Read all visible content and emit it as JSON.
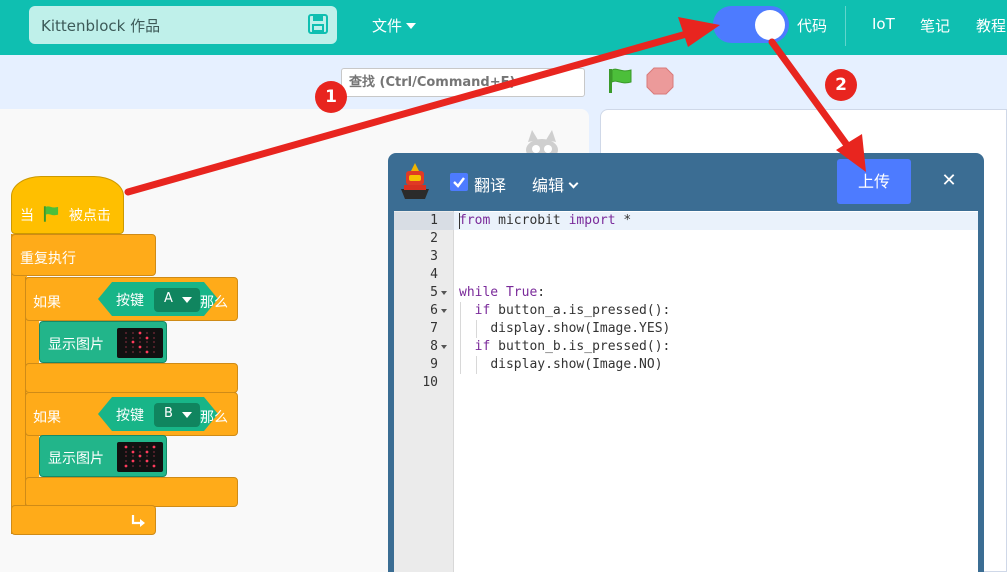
{
  "header": {
    "project_title": "Kittenblock 作品",
    "file_menu": "文件",
    "code_toggle_label": "代码",
    "nav": [
      "IoT",
      "笔记",
      "教程"
    ]
  },
  "toolbar": {
    "search_placeholder": "查找 (Ctrl/Command+F)"
  },
  "blocks": {
    "hat": {
      "prefix": "当",
      "suffix": "被点击"
    },
    "forever": "重复执行",
    "if_blocks": [
      {
        "if": "如果",
        "sensor": "按键",
        "value": "A",
        "then": "那么",
        "action": "显示图片"
      },
      {
        "if": "如果",
        "sensor": "按键",
        "value": "B",
        "then": "那么",
        "action": "显示图片"
      }
    ]
  },
  "editor": {
    "translate_label": "翻译",
    "translate_checked": true,
    "edit_menu": "编辑",
    "upload_button": "上传",
    "line_numbers": [
      "1",
      "2",
      "3",
      "4",
      "5",
      "6",
      "7",
      "8",
      "9",
      "10"
    ],
    "code_lines": [
      "from microbit import *",
      "",
      "",
      "",
      "while True:",
      "  if button_a.is_pressed():",
      "    display.show(Image.YES)",
      "  if button_b.is_pressed():",
      "    display.show(Image.NO)",
      ""
    ]
  },
  "annotations": {
    "badge_1": "1",
    "badge_2": "2",
    "arrow_color": "#e8251f"
  },
  "colors": {
    "topbar": "#0fbfb1",
    "accent": "#4d7bff",
    "event_block": "#ffbf00",
    "control_block": "#ffab19",
    "sensor_block": "#18b588",
    "editor_frame": "#3b6d93"
  }
}
